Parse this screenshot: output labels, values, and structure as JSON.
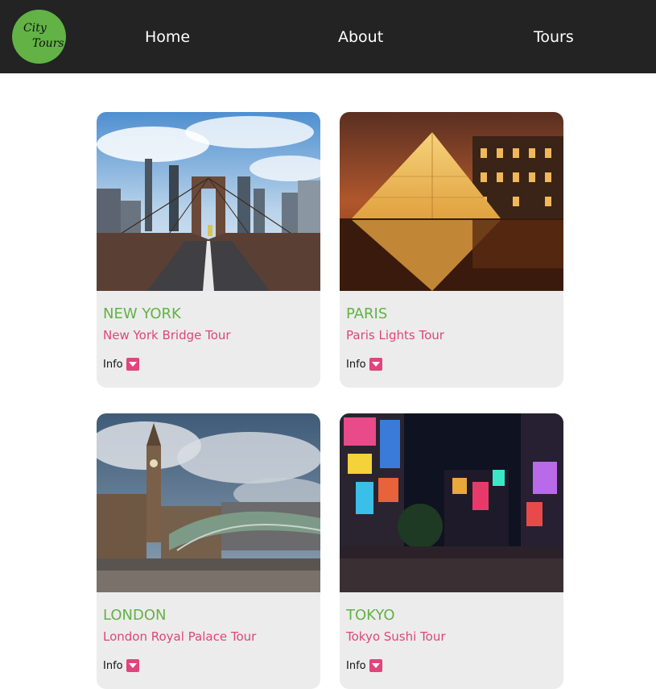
{
  "header": {
    "logo_line1": "City",
    "logo_line2": "Tours",
    "nav": [
      "Home",
      "About",
      "Tours"
    ]
  },
  "tours": [
    {
      "city": "NEW YORK",
      "tour": "New York Bridge Tour",
      "info_label": "Info"
    },
    {
      "city": "PARIS",
      "tour": "Paris Lights Tour",
      "info_label": "Info"
    },
    {
      "city": "LONDON",
      "tour": "London Royal Palace Tour",
      "info_label": "Info"
    },
    {
      "city": "TOKYO",
      "tour": "Tokyo Sushi Tour",
      "info_label": "Info"
    }
  ],
  "colors": {
    "nav_bg": "#232323",
    "brand_green": "#62b246",
    "accent_pink": "#e0457b",
    "card_bg": "#ececec"
  }
}
